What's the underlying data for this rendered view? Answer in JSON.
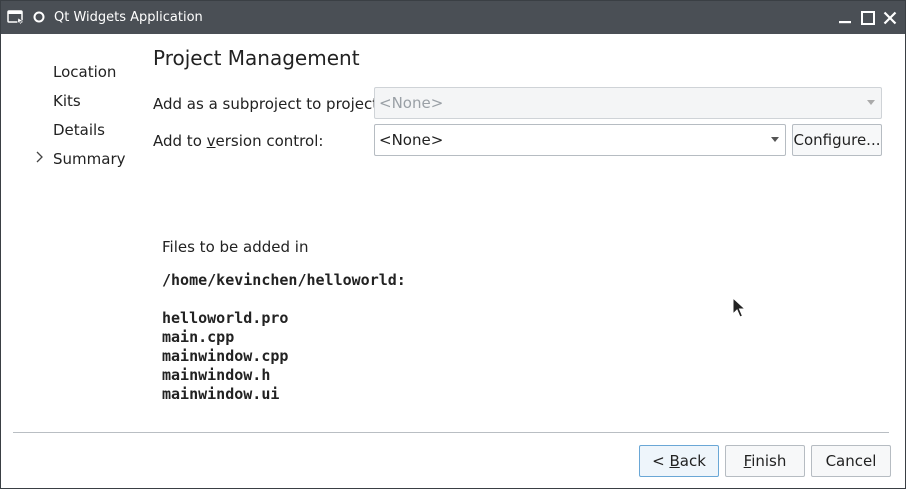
{
  "window": {
    "title": "Qt Widgets Application"
  },
  "titlebar": {
    "icons": [
      "app-menu-icon",
      "pin-icon"
    ],
    "controls": [
      "minimize-icon",
      "maximize-icon",
      "close-icon"
    ]
  },
  "sidebar": {
    "items": [
      {
        "label": "Location"
      },
      {
        "label": "Kits"
      },
      {
        "label": "Details"
      },
      {
        "label": "Summary",
        "current": true
      }
    ],
    "current_marker_icon": "chevron-right-icon"
  },
  "main": {
    "title": "Project Management",
    "subproject_label": "Add as a subproject to project:",
    "subproject_value": "<None>",
    "vcs_label": "Add to version control:",
    "vcs_value": "<None>",
    "configure_label": "Configure...",
    "files_intro": "Files to be added in",
    "files_dir": "/home/kevinchen/helloworld:",
    "files": [
      "helloworld.pro",
      "main.cpp",
      "mainwindow.cpp",
      "mainwindow.h",
      "mainwindow.ui"
    ]
  },
  "footer": {
    "back_label": "< Back",
    "finish_label": "Finish",
    "cancel_label": "Cancel"
  },
  "colors": {
    "titlebar_bg": "#4a4f55",
    "default_button_border": "#6aa7d6"
  }
}
